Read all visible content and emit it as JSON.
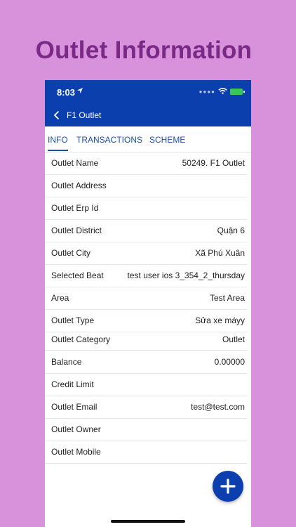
{
  "banner": {
    "title": "Outlet Information"
  },
  "status_bar": {
    "time": "8:03"
  },
  "nav": {
    "title": "F1 Outlet"
  },
  "tabs": [
    {
      "label": "INFO"
    },
    {
      "label": "TRANSACTIONS"
    },
    {
      "label": "SCHEME"
    }
  ],
  "fields": [
    {
      "label": "Outlet Name",
      "value": "50249. F1 Outlet"
    },
    {
      "label": "Outlet Address",
      "value": ""
    },
    {
      "label": "Outlet Erp Id",
      "value": ""
    },
    {
      "label": "Outlet District",
      "value": "Quận 6"
    },
    {
      "label": "Outlet City",
      "value": "Xã Phú Xuân"
    },
    {
      "label": "Selected Beat",
      "value": "test user ios 3_354_2_thursday"
    },
    {
      "label": "Area",
      "value": "Test Area"
    },
    {
      "label": "Outlet Type",
      "value": "Sửa xe máyy"
    },
    {
      "label": "Outlet Category",
      "value": "Outlet"
    },
    {
      "label": "Balance",
      "value": "0.00000"
    },
    {
      "label": "Credit Limit",
      "value": ""
    },
    {
      "label": "Outlet Email",
      "value": "test@test.com"
    },
    {
      "label": "Outlet Owner",
      "value": ""
    },
    {
      "label": "Outlet Mobile",
      "value": ""
    }
  ],
  "colors": {
    "primary": "#0c3fae",
    "background": "#d892dc",
    "banner_text": "#7a2a86",
    "tab_text": "#1b4fa8"
  },
  "icons": {
    "back": "chevron-left-icon",
    "fab": "plus-icon",
    "location": "location-arrow-icon",
    "wifi": "wifi-icon",
    "battery": "battery-icon"
  }
}
